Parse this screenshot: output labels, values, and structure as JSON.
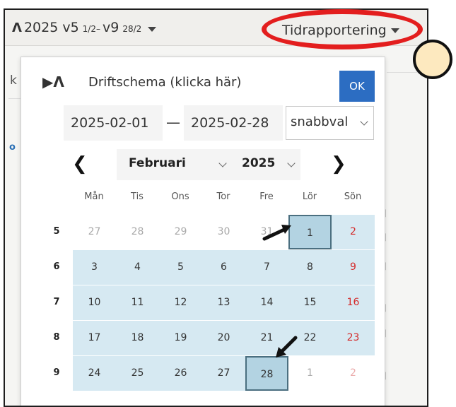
{
  "topbar": {
    "version": {
      "logo_icon": "A-logo-icon",
      "label": "2025 v5",
      "range_start": "1/2–",
      "label_end": "v9",
      "range_end": "28/2"
    },
    "report_menu": {
      "label": "Tidrapportering"
    }
  },
  "background": {
    "sliver_left": "k",
    "sliver_blue": "o"
  },
  "popup": {
    "schedule": {
      "icon": "play-logo-icon",
      "label": "Driftschema (klicka här)"
    },
    "ok_label": "OK",
    "date_from": "2025-02-01",
    "date_separator": "—",
    "date_to": "2025-02-28",
    "quick_select": "snabbval",
    "nav": {
      "prev": "❮",
      "next": "❯",
      "month": "Februari",
      "year": "2025"
    },
    "weekdays": [
      "Mån",
      "Tis",
      "Ons",
      "Tor",
      "Fre",
      "Lör",
      "Sön"
    ],
    "weeks": [
      {
        "week": "5",
        "days": [
          "27",
          "28",
          "29",
          "30",
          "31",
          "1",
          "2"
        ]
      },
      {
        "week": "6",
        "days": [
          "3",
          "4",
          "5",
          "6",
          "7",
          "8",
          "9"
        ]
      },
      {
        "week": "7",
        "days": [
          "10",
          "11",
          "12",
          "13",
          "14",
          "15",
          "16"
        ]
      },
      {
        "week": "8",
        "days": [
          "17",
          "18",
          "19",
          "20",
          "21",
          "22",
          "23"
        ]
      },
      {
        "week": "9",
        "days": [
          "24",
          "25",
          "26",
          "27",
          "28",
          "1",
          "2"
        ]
      }
    ]
  },
  "colors": {
    "accent": "#2c6dc2",
    "range": "#d6e9f2",
    "selected": "#b3d3e2",
    "holiday": "#d42a2a",
    "annotation": "#e31e1e",
    "marker": "#fde9bf"
  }
}
